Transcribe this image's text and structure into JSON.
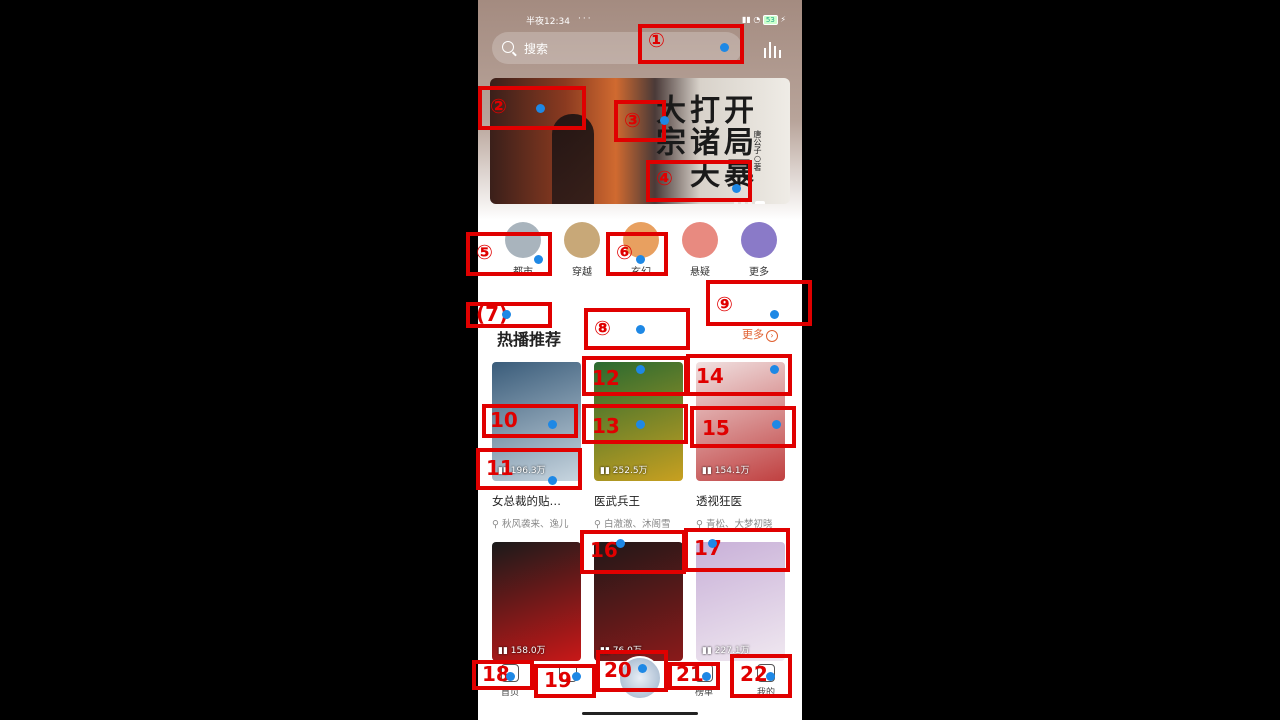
{
  "status_bar": {
    "time": "半夜12:34",
    "icons": "··· ",
    "battery": "53"
  },
  "search": {
    "placeholder": "搜索"
  },
  "banner": {
    "title": "开局暴打诸天大宗",
    "author": "唐公子○著"
  },
  "categories": [
    {
      "label": "都市",
      "icon": "book-icon",
      "color": "#a9b4bd"
    },
    {
      "label": "穿越",
      "icon": "spiral-icon",
      "color": "#c8a878"
    },
    {
      "label": "玄幻",
      "icon": "gem-icon",
      "color": "#e8a060"
    },
    {
      "label": "悬疑",
      "icon": "helmet-icon",
      "color": "#e88a80"
    },
    {
      "label": "更多",
      "icon": "grid-icon",
      "color": "#8a7ac8"
    }
  ],
  "section": {
    "title": "热播推荐",
    "more": "更多"
  },
  "books": [
    {
      "name": "女总裁的贴…",
      "authors": "秋风袭来、逸儿",
      "plays": "196.3万",
      "colors": [
        "#3a5c7a",
        "#c8d6e0"
      ]
    },
    {
      "name": "医武兵王",
      "authors": "白澈澈、沐阁雪",
      "plays": "252.5万",
      "colors": [
        "#2a6a30",
        "#c8a020"
      ]
    },
    {
      "name": "透视狂医",
      "authors": "青松、大梦初晓",
      "plays": "154.1万",
      "colors": [
        "#f0e0e0",
        "#c04040"
      ]
    },
    {
      "name": "",
      "authors": "",
      "plays": "158.0万",
      "colors": [
        "#1a1a1a",
        "#c81818"
      ]
    },
    {
      "name": "",
      "authors": "",
      "plays": "76.0万",
      "colors": [
        "#201818",
        "#8a1a1a"
      ]
    },
    {
      "name": "",
      "authors": "",
      "plays": "227.1万",
      "colors": [
        "#c8b0d8",
        "#f0e8f0"
      ]
    }
  ],
  "nav": [
    {
      "label": "首页",
      "icon": "home-icon"
    },
    {
      "label": "",
      "icon": "category-icon"
    },
    {
      "label": "",
      "icon": "player-icon"
    },
    {
      "label": "榜单",
      "icon": "rank-icon"
    },
    {
      "label": "我的",
      "icon": "profile-icon"
    }
  ],
  "markers": [
    {
      "num": "①"
    },
    {
      "num": "②"
    },
    {
      "num": "③"
    },
    {
      "num": "④"
    },
    {
      "num": "⑤"
    },
    {
      "num": "⑥"
    },
    {
      "num": "(7)"
    },
    {
      "num": "⑧"
    },
    {
      "num": "⑨"
    },
    {
      "num": "10"
    },
    {
      "num": "11"
    },
    {
      "num": "12"
    },
    {
      "num": "13"
    },
    {
      "num": "14"
    },
    {
      "num": "15"
    },
    {
      "num": "16"
    },
    {
      "num": "17"
    },
    {
      "num": "18"
    },
    {
      "num": "19"
    },
    {
      "num": "20"
    },
    {
      "num": "21"
    },
    {
      "num": "22"
    }
  ]
}
